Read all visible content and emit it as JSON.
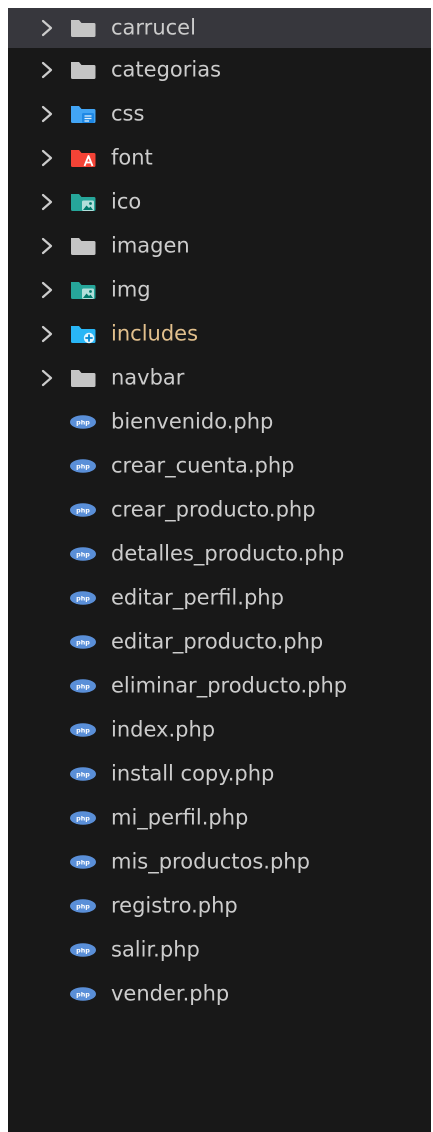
{
  "explorer": {
    "colors": {
      "background": "#181818",
      "selected_row": "#37373d",
      "text": "#cccccc",
      "modified_text": "#e2c08d",
      "folder_gray": "#c5c5c5",
      "css_blue": "#42a5f5",
      "font_red": "#f44336",
      "image_teal": "#26a69a",
      "php_blue": "#5a8fd8"
    },
    "folders": [
      {
        "name": "carrucel",
        "icon": "folder-icon"
      },
      {
        "name": "categorias",
        "icon": "folder-icon"
      },
      {
        "name": "css",
        "icon": "folder-css-icon"
      },
      {
        "name": "font",
        "icon": "folder-font-icon"
      },
      {
        "name": "ico",
        "icon": "folder-images-icon"
      },
      {
        "name": "imagen",
        "icon": "folder-icon"
      },
      {
        "name": "img",
        "icon": "folder-images-icon"
      },
      {
        "name": "includes",
        "icon": "folder-include-icon",
        "modified": true
      },
      {
        "name": "navbar",
        "icon": "folder-icon"
      }
    ],
    "files": [
      {
        "name": "bienvenido.php",
        "icon": "php-icon"
      },
      {
        "name": "crear_cuenta.php",
        "icon": "php-icon"
      },
      {
        "name": "crear_producto.php",
        "icon": "php-icon"
      },
      {
        "name": "detalles_producto.php",
        "icon": "php-icon"
      },
      {
        "name": "editar_perfil.php",
        "icon": "php-icon"
      },
      {
        "name": "editar_producto.php",
        "icon": "php-icon"
      },
      {
        "name": "eliminar_producto.php",
        "icon": "php-icon"
      },
      {
        "name": "index.php",
        "icon": "php-icon"
      },
      {
        "name": "install copy.php",
        "icon": "php-icon"
      },
      {
        "name": "mi_perfil.php",
        "icon": "php-icon"
      },
      {
        "name": "mis_productos.php",
        "icon": "php-icon"
      },
      {
        "name": "registro.php",
        "icon": "php-icon"
      },
      {
        "name": "salir.php",
        "icon": "php-icon"
      },
      {
        "name": "vender.php",
        "icon": "php-icon"
      }
    ]
  }
}
